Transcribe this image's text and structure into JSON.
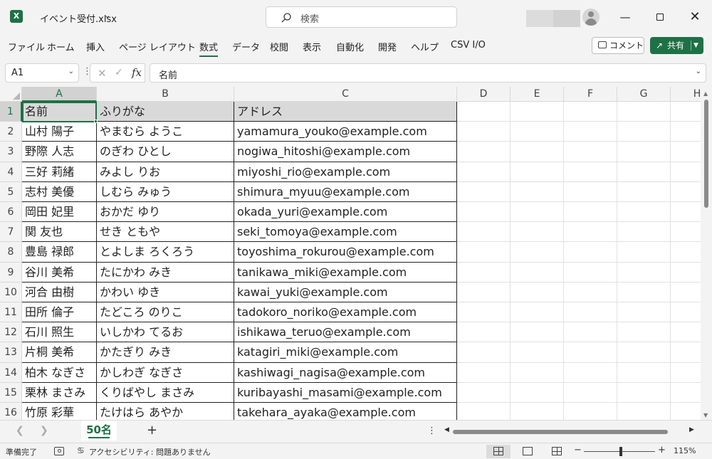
{
  "titlebar": {
    "app_icon": "excel-icon",
    "app_icon_letter": "X",
    "file_name": "イベント受付.xlsx",
    "search_placeholder": "検索"
  },
  "ribbon": {
    "tabs": [
      "ファイル",
      "ホーム",
      "挿入",
      "ページ レイアウト",
      "数式",
      "データ",
      "校閲",
      "表示",
      "自動化",
      "開発",
      "ヘルプ",
      "CSV I/O"
    ],
    "active_tab": "数式",
    "comment_label": "コメント",
    "share_label": "共有"
  },
  "formula_bar": {
    "name_box": "A1",
    "formula": "名前"
  },
  "sheet": {
    "columns": [
      "A",
      "B",
      "C",
      "D",
      "E",
      "F",
      "G",
      "H"
    ],
    "row_numbers": [
      "1",
      "2",
      "3",
      "4",
      "5",
      "6",
      "7",
      "8",
      "9",
      "10",
      "11",
      "12",
      "13",
      "14",
      "15",
      "16"
    ],
    "rows": [
      [
        "名前",
        "ふりがな",
        "アドレス"
      ],
      [
        "山村 陽子",
        "やまむら ようこ",
        "yamamura_youko@example.com"
      ],
      [
        "野際 人志",
        "のぎわ ひとし",
        "nogiwa_hitoshi@example.com"
      ],
      [
        "三好 莉緒",
        "みよし りお",
        "miyoshi_rio@example.com"
      ],
      [
        "志村 美優",
        "しむら みゅう",
        "shimura_myuu@example.com"
      ],
      [
        "岡田 妃里",
        "おかだ ゆり",
        "okada_yuri@example.com"
      ],
      [
        "関 友也",
        "せき ともや",
        "seki_tomoya@example.com"
      ],
      [
        "豊島 禄郎",
        "とよしま ろくろう",
        "toyoshima_rokurou@example.com"
      ],
      [
        "谷川 美希",
        "たにかわ みき",
        "tanikawa_miki@example.com"
      ],
      [
        "河合 由樹",
        "かわい ゆき",
        "kawai_yuki@example.com"
      ],
      [
        "田所 倫子",
        "たどころ のりこ",
        "tadokoro_noriko@example.com"
      ],
      [
        "石川 照生",
        "いしかわ てるお",
        "ishikawa_teruo@example.com"
      ],
      [
        "片桐 美希",
        "かたぎり みき",
        "katagiri_miki@example.com"
      ],
      [
        "柏木 なぎさ",
        "かしわぎ なぎさ",
        "kashiwagi_nagisa@example.com"
      ],
      [
        "栗林 まさみ",
        "くりばやし まさみ",
        "kuribayashi_masami@example.com"
      ],
      [
        "竹原 彩華",
        "たけはら あやか",
        "takehara_ayaka@example.com"
      ]
    ],
    "selected_cell": "A1"
  },
  "sheet_tabs": {
    "tabs": [
      "50名"
    ],
    "active": "50名"
  },
  "statusbar": {
    "ready": "準備完了",
    "accessibility": "アクセシビリティ: 問題ありません",
    "zoom": "115%"
  },
  "colors": {
    "excel_green": "#1e7145",
    "header_fill": "#d9d9d9"
  }
}
